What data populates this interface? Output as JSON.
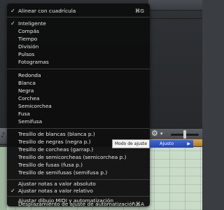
{
  "menu": {
    "items": [
      {
        "label": "Alinear con cuadrícula",
        "checked": true,
        "shortcut": "⌘G"
      },
      {
        "label": "Inteligente",
        "checked": true
      },
      {
        "label": "Compás"
      },
      {
        "label": "Tiempo"
      },
      {
        "label": "División"
      },
      {
        "label": "Pulsos"
      },
      {
        "label": "Fotogramas"
      },
      {
        "label": "Redonda"
      },
      {
        "label": "Blanca"
      },
      {
        "label": "Negra"
      },
      {
        "label": "Corchea"
      },
      {
        "label": "Semicorchea"
      },
      {
        "label": "Fusa"
      },
      {
        "label": "Semifusa"
      },
      {
        "label": "Tresillo de blancas (blanca p.)"
      },
      {
        "label": "Tresillo de negras (negra p.)"
      },
      {
        "label": "Tresillo de corcheas (garrap.)"
      },
      {
        "label": "Tresillo de semicorcheas (semicorchea p.)"
      },
      {
        "label": "Tresillo de fusas (fusa p.)"
      },
      {
        "label": "Tresillo de semifusas (semifusa p.)"
      },
      {
        "label": "Ajustar notas a valor absoluto"
      },
      {
        "label": "Ajustar notas a valor relativo",
        "checked": true
      },
      {
        "label": "Ajustar dibujo MIDI y automatización"
      },
      {
        "label": "Desplazamiento de ajuste de automatización…",
        "shortcut": "⌃⌘A"
      }
    ]
  },
  "check_mark": "✓",
  "tooltip": {
    "text": "Modo de ajuste"
  },
  "submenu": {
    "label": "Ajusto",
    "arrow": "▶"
  },
  "toolbar": {
    "gear_glyph": "⚙",
    "caret_glyph": "▾",
    "left_icon_glyph": "♪"
  },
  "colors": {
    "menu_bg": "#0e0e0e",
    "highlight": "#2446b0",
    "tooltip_bg": "#f2f2f2",
    "grid_bg": "#c9dcc8",
    "yellow_strip": "#d9a84a"
  }
}
